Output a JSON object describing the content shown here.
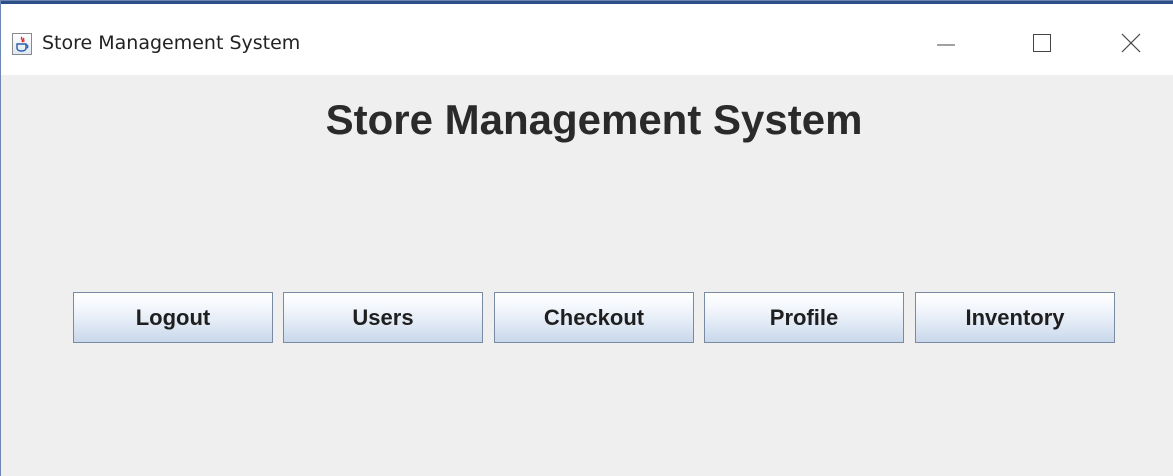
{
  "window": {
    "title": "Store Management System",
    "app_icon": "java-icon",
    "controls": {
      "minimize": "minimize-icon",
      "maximize": "maximize-icon",
      "close": "close-icon"
    }
  },
  "main": {
    "heading": "Store Management System",
    "buttons": [
      {
        "label": "Logout"
      },
      {
        "label": "Users"
      },
      {
        "label": "Checkout"
      },
      {
        "label": "Profile"
      },
      {
        "label": "Inventory"
      }
    ]
  },
  "colors": {
    "titlebar_bg": "#ffffff",
    "content_bg": "#efefef",
    "button_gradient_top": "#ffffff",
    "button_gradient_bottom": "#c9d8eb",
    "button_border": "#7a8aa3"
  }
}
